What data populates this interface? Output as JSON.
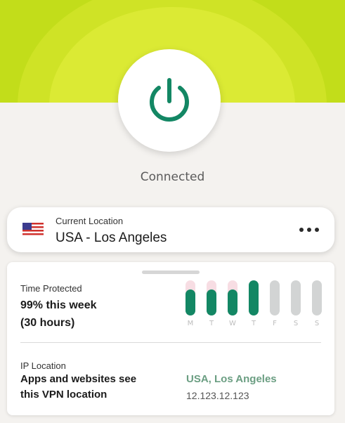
{
  "colors": {
    "accent": "#138764",
    "banner_outer": "#c2dd1a",
    "banner_inner": "#dbea34",
    "bar_inactive": "#d2d4d4",
    "bar_track_pink": "#f7dde3",
    "ip_green": "#6b9e82"
  },
  "vpn": {
    "power_icon": "power-icon",
    "status": "Connected"
  },
  "location": {
    "flag_icon": "us-flag-icon",
    "label": "Current Location",
    "value": "USA - Los Angeles",
    "more_icon": "more-horizontal-icon"
  },
  "time_protected": {
    "label": "Time Protected",
    "summary": "99% this week",
    "hours": "(30 hours)",
    "days": [
      {
        "label": "M",
        "level": 0.74,
        "active": true
      },
      {
        "label": "T",
        "level": 0.74,
        "active": true
      },
      {
        "label": "W",
        "level": 0.74,
        "active": true
      },
      {
        "label": "T",
        "level": 1.0,
        "active": true
      },
      {
        "label": "F",
        "level": 1.0,
        "active": false
      },
      {
        "label": "S",
        "level": 1.0,
        "active": false
      },
      {
        "label": "S",
        "level": 1.0,
        "active": false
      }
    ]
  },
  "ip_location": {
    "label": "IP Location",
    "description_line1": "Apps and websites see",
    "description_line2": "this VPN location",
    "country": "USA, Los Angeles",
    "address": "12.123.12.123"
  }
}
